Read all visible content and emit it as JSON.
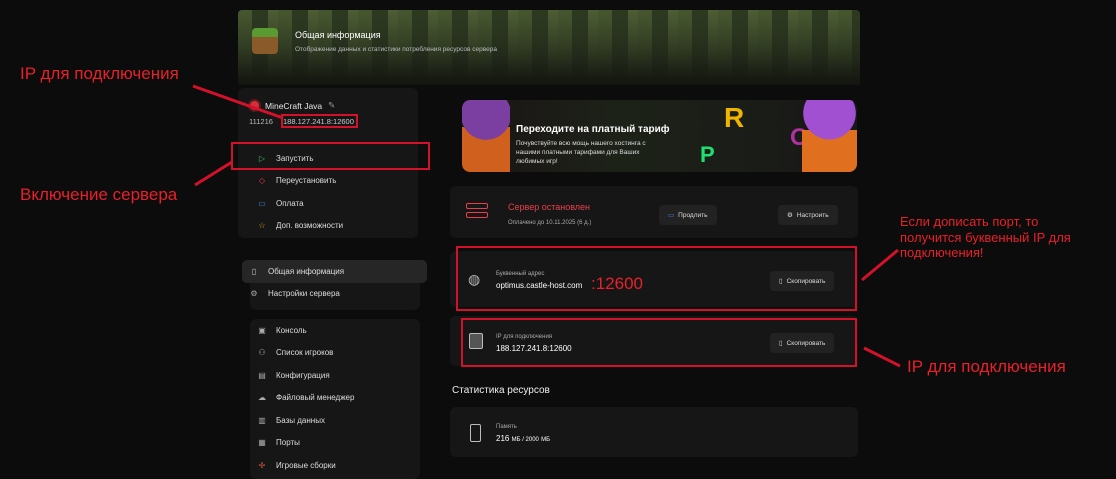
{
  "header": {
    "title": "Общая информация",
    "subtitle": "Отображение данных и статистики потребления ресурсов сервера"
  },
  "server": {
    "name": "MineCraft Java",
    "id": "111216",
    "ip": "188.127.241.8:12600"
  },
  "actions": [
    {
      "label": "Запустить",
      "icon": "play-icon"
    },
    {
      "label": "Переустановить",
      "icon": "eraser-icon"
    },
    {
      "label": "Оплата",
      "icon": "wallet-icon"
    },
    {
      "label": "Доп. возможности",
      "icon": "star-icon"
    }
  ],
  "nav_main": [
    {
      "label": "Общая информация",
      "icon": "clipboard-icon",
      "active": true
    },
    {
      "label": "Настройки сервера",
      "icon": "gear-icon"
    }
  ],
  "nav_tools": [
    {
      "label": "Консоль",
      "icon": "terminal-icon"
    },
    {
      "label": "Список игроков",
      "icon": "users-icon"
    },
    {
      "label": "Конфигурация",
      "icon": "file-icon"
    },
    {
      "label": "Файловый менеджер",
      "icon": "cloud-icon"
    },
    {
      "label": "Базы данных",
      "icon": "database-icon"
    },
    {
      "label": "Порты",
      "icon": "ethernet-icon"
    },
    {
      "label": "Игровые сборки",
      "icon": "puzzle-icon"
    }
  ],
  "banner": {
    "title": "Переходите на платный тариф",
    "text": "Почувствуйте всю мощь нашего хостинга с нашими платными тарифами для Ваших любимых игр!",
    "letters": [
      "R",
      "P",
      "O"
    ]
  },
  "status": {
    "text": "Сервер остановлен",
    "paid": "Оплачено до 10.11.2025 (6 д.)",
    "extend": "Продлить",
    "configure": "Настроить",
    "color": "#e8404a"
  },
  "domain": {
    "label": "Буквенный адрес",
    "value": "optimus.castle-host.com",
    "port_annotation": ":12600",
    "copy": "Скопировать"
  },
  "ip": {
    "label": "IP для подключения",
    "value": "188.127.241.8:12600",
    "copy": "Скопировать"
  },
  "stats": {
    "title": "Статистика ресурсов",
    "memory_label": "Память",
    "memory_used": "216",
    "memory_total": "2000",
    "unit": "МБ"
  },
  "annotations": {
    "ip_left": "IP для подключения",
    "start": "Включение сервера",
    "hint": "Если дописать порт, то получится буквенный IP для подключения!",
    "ip_right": "IP для подключения"
  }
}
